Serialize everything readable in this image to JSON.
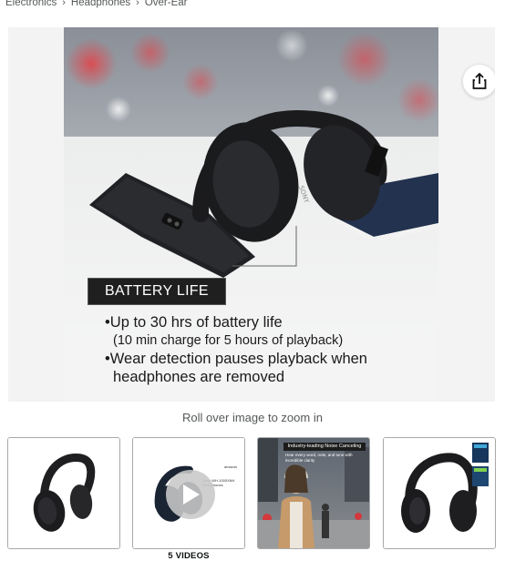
{
  "breadcrumb": {
    "items": [
      "Electronics",
      "Headphones",
      "Over-Ear"
    ],
    "separator": "›"
  },
  "main_image": {
    "icon": "headphones-product-photo",
    "label": "BATTERY LIFE",
    "bullets": [
      "•Up to 30 hrs of battery life",
      "(10 min charge for 5 hours of playback)",
      "•Wear detection pauses playback when",
      "headphones are removed"
    ],
    "brand_mark": "SONY"
  },
  "share": {
    "icon": "share-icon"
  },
  "zoom_hint": "Roll over image to zoom in",
  "thumbnails": [
    {
      "icon": "headphones-thumbnail"
    },
    {
      "icon": "video-thumbnail",
      "caption": "Sony WH-1000XM4 Headphones",
      "logo": "amazon",
      "footer": "5 VIDEOS"
    },
    {
      "icon": "noise-cancelling-thumbnail",
      "banner": "Industry-leading Noise Canceling",
      "sub": "Hear every word, note, and tune with incredible clarity"
    },
    {
      "icon": "headphones-award-thumbnail"
    }
  ],
  "colors": {
    "text": "#0f1111",
    "secondary": "#565959",
    "border": "#a9a9a9"
  }
}
